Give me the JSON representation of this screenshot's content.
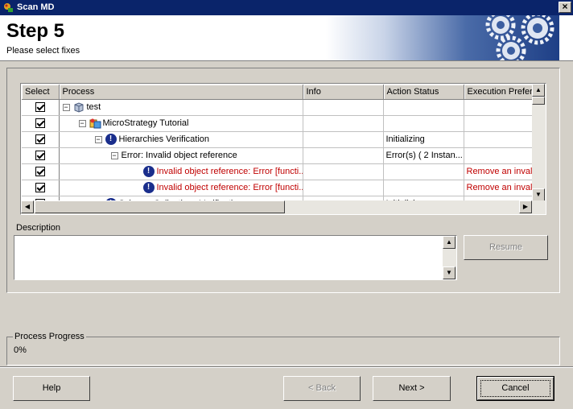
{
  "window": {
    "title": "Scan MD",
    "close_glyph": "×"
  },
  "header": {
    "step": "Step 5",
    "subtitle": "Please select fixes"
  },
  "grid": {
    "columns": [
      "Select",
      "Process",
      "Info",
      "Action Status",
      "Execution Prefer..."
    ],
    "rows": [
      {
        "indent": 0,
        "toggle": "−",
        "icon": "box-icon",
        "process": "test",
        "info": "",
        "status": "",
        "exec": "",
        "red": false
      },
      {
        "indent": 1,
        "toggle": "−",
        "icon": "project-icon",
        "process": "MicroStrategy Tutorial",
        "info": "",
        "status": "",
        "exec": "",
        "red": false
      },
      {
        "indent": 2,
        "toggle": "−",
        "icon": "alert-icon",
        "process": "Hierarchies Verification",
        "info": "",
        "status": "Initializing",
        "exec": "",
        "red": false
      },
      {
        "indent": 3,
        "toggle": "−",
        "icon": "",
        "process": "Error: Invalid object reference",
        "info": "",
        "status": "Error(s) ( 2 Instan...",
        "exec": "",
        "red": false
      },
      {
        "indent": 5,
        "toggle": "",
        "icon": "alert-icon",
        "process": "Invalid object reference: Error [functi...",
        "info": "",
        "status": "",
        "exec": "Remove an invali",
        "red": true
      },
      {
        "indent": 5,
        "toggle": "",
        "icon": "alert-icon",
        "process": "Invalid object reference: Error [functi...",
        "info": "",
        "status": "",
        "exec": "Remove an invali",
        "red": true
      },
      {
        "indent": 2,
        "toggle": "−",
        "icon": "alert-icon",
        "process": "Schema Collections Verification",
        "info": "",
        "status": "Initializing",
        "exec": "",
        "red": false
      }
    ]
  },
  "description": {
    "label": "Description",
    "value": ""
  },
  "buttons": {
    "resume": "Resume",
    "help": "Help",
    "back": "< Back",
    "next": "Next >",
    "cancel": "Cancel"
  },
  "progress": {
    "label": "Process Progress",
    "value": "0%"
  }
}
